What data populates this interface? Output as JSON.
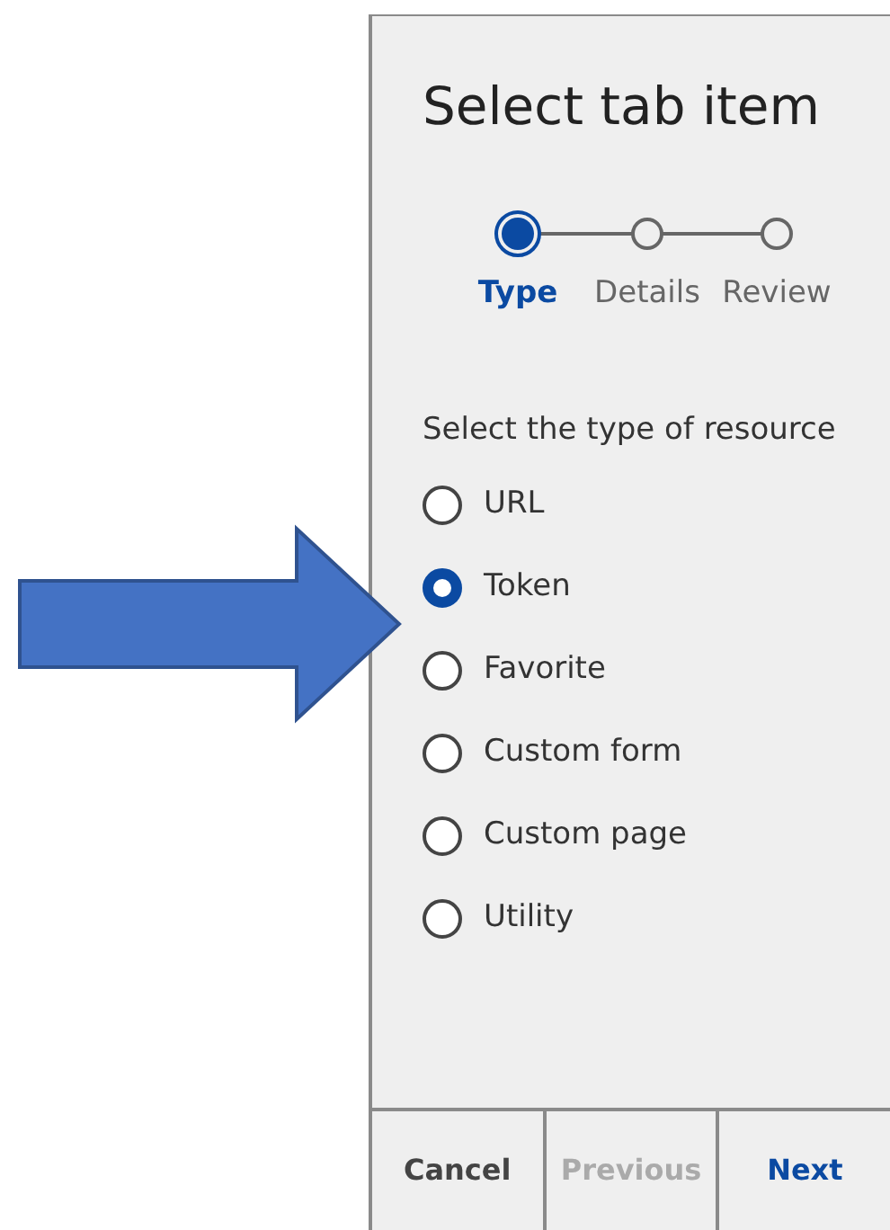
{
  "title": "Select tab item",
  "steps": [
    {
      "label": "Type",
      "selected": true
    },
    {
      "label": "Details",
      "selected": false
    },
    {
      "label": "Review",
      "selected": false
    }
  ],
  "prompt": "Select the type of resource",
  "options": [
    {
      "label": "URL",
      "selected": false
    },
    {
      "label": "Token",
      "selected": true
    },
    {
      "label": "Favorite",
      "selected": false
    },
    {
      "label": "Custom form",
      "selected": false
    },
    {
      "label": "Custom page",
      "selected": false
    },
    {
      "label": "Utility",
      "selected": false
    }
  ],
  "buttons": [
    {
      "label": "Cancel",
      "disabled": false,
      "primary": false
    },
    {
      "label": "Previous",
      "disabled": true,
      "primary": false
    },
    {
      "label": "Next",
      "disabled": false,
      "primary": true
    }
  ]
}
